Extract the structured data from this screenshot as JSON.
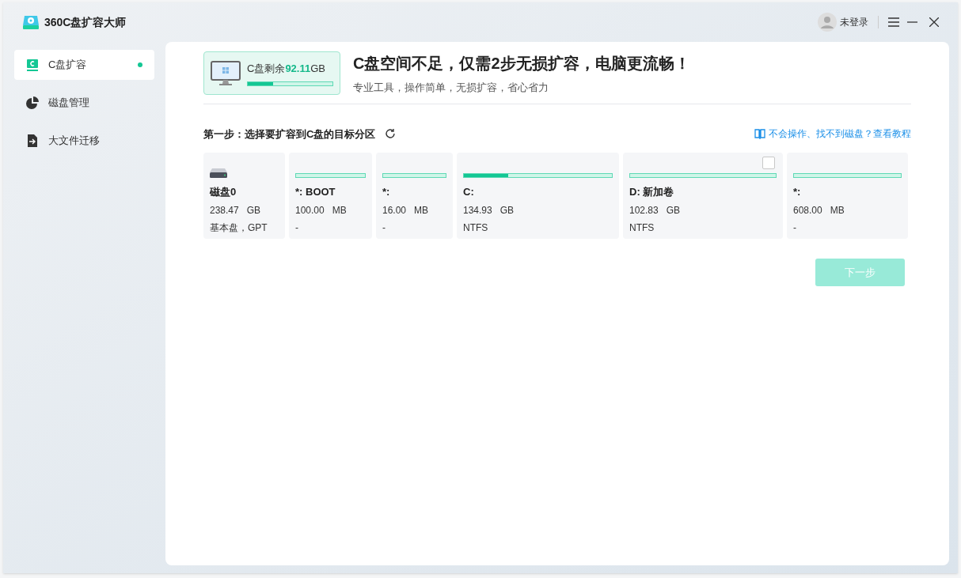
{
  "window": {
    "title": "360C盘扩容大师"
  },
  "account": {
    "label": "未登录"
  },
  "sidebar": {
    "items": [
      {
        "label": "C盘扩容",
        "selected": true
      },
      {
        "label": "磁盘管理",
        "selected": false
      },
      {
        "label": "大文件迁移",
        "selected": false
      }
    ]
  },
  "summary": {
    "label": "C盘剩余",
    "value": "92.11",
    "unit": "GB",
    "level": 0.3
  },
  "headline": {
    "title": "C盘空间不足，仅需2步无损扩容，电脑更流畅！",
    "subtitle": "专业工具，操作简单，无损扩容，省心省力"
  },
  "step": {
    "label": "第一步：选择要扩容到C盘的目标分区",
    "help_link": "不会操作、找不到磁盘？查看教程"
  },
  "partitions": [
    {
      "kind": "disk",
      "name": "磁盘0",
      "size": "238.47",
      "unit": "GB",
      "detail": "基本盘，GPT"
    },
    {
      "kind": "partition",
      "name": "*: BOOT",
      "size": "100.00",
      "unit": "MB",
      "detail": "-",
      "level": 0
    },
    {
      "kind": "partition",
      "name": "*:",
      "size": "16.00",
      "unit": "MB",
      "detail": "-",
      "level": 0
    },
    {
      "kind": "partition",
      "name": "C:",
      "size": "134.93",
      "unit": "GB",
      "detail": "NTFS",
      "level": 0.3
    },
    {
      "kind": "target",
      "name": "D: 新加卷",
      "size": "102.83",
      "unit": "GB",
      "detail": "NTFS",
      "level": 0,
      "checked": false
    },
    {
      "kind": "partition",
      "name": "*:",
      "size": "608.00",
      "unit": "MB",
      "detail": "-",
      "level": 0
    }
  ],
  "next_button": {
    "label": "下一步",
    "disabled": true
  }
}
